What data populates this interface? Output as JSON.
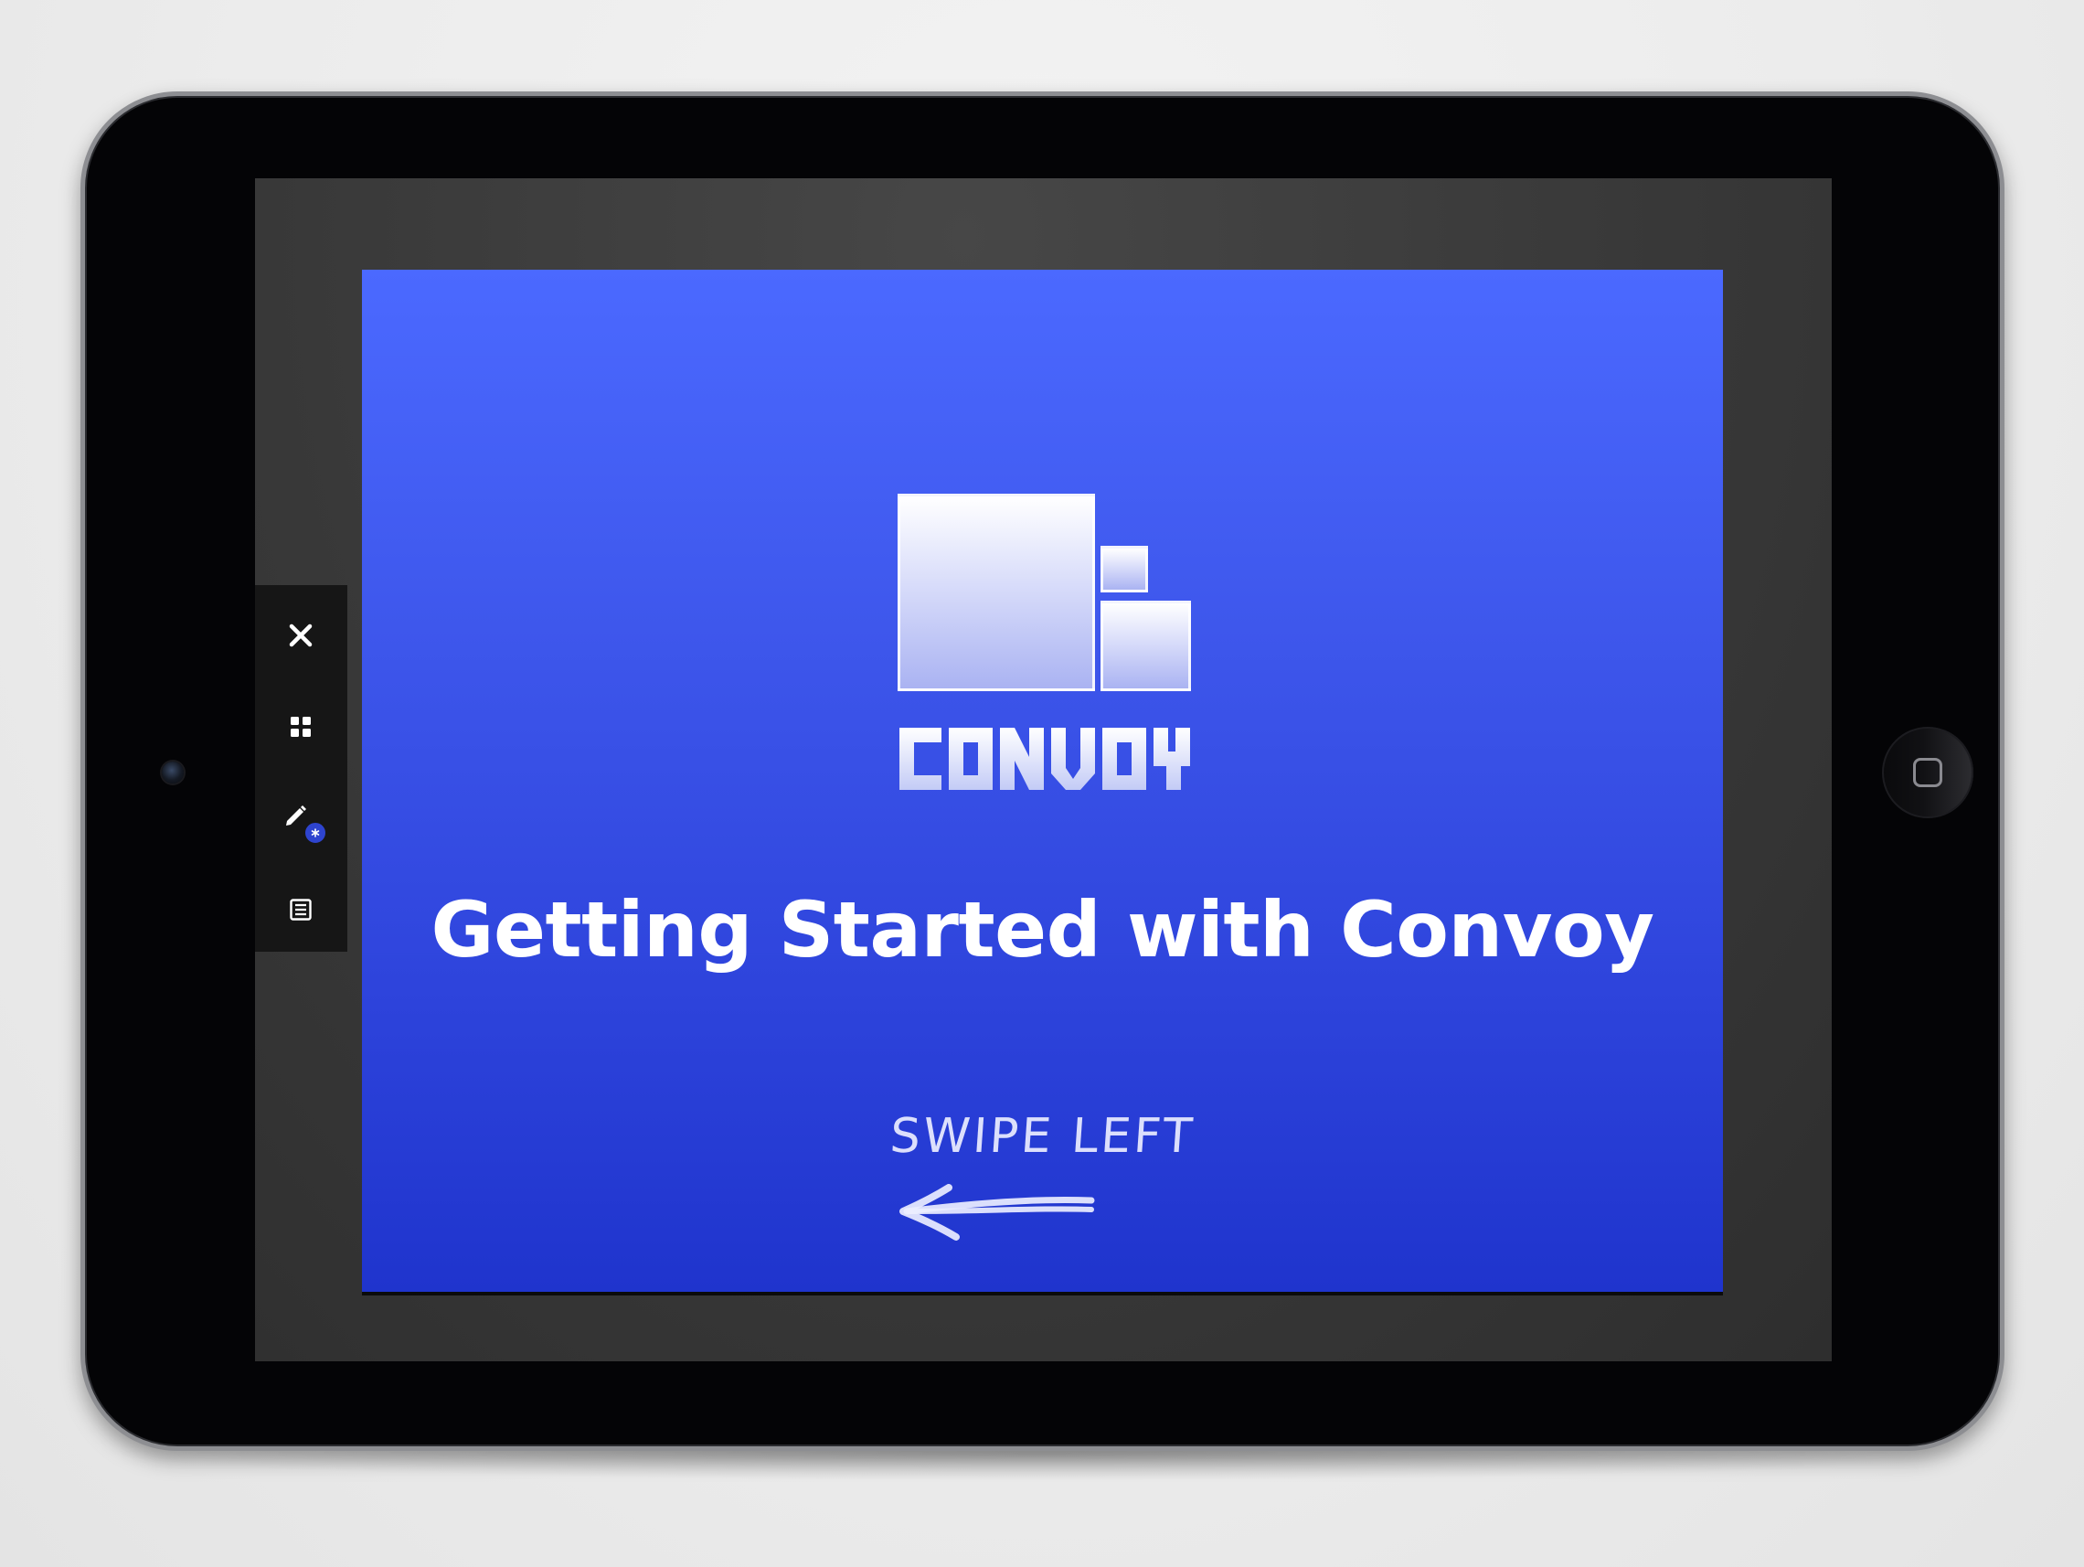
{
  "toolbar": {
    "items": [
      {
        "name": "close",
        "icon": "close-icon"
      },
      {
        "name": "grid-view",
        "icon": "grid-icon"
      },
      {
        "name": "annotate",
        "icon": "pencil-icon",
        "badge": "*"
      },
      {
        "name": "notes",
        "icon": "list-icon"
      }
    ]
  },
  "slide": {
    "logo_text": "CONVOY",
    "title": "Getting Started with Convoy",
    "hint": "SWIPE LEFT",
    "hint_icon": "arrow-left-icon",
    "colors": {
      "background_top": "#4b69ff",
      "background_bottom": "#1f34cd",
      "text": "#ffffff"
    }
  }
}
